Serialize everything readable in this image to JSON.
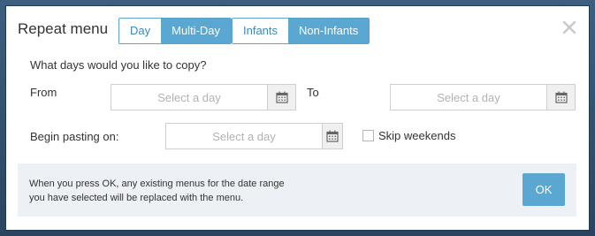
{
  "dialog": {
    "title": "Repeat menu",
    "close_icon": "close-icon"
  },
  "range_toggle": {
    "options": [
      "Day",
      "Multi-Day"
    ],
    "selected": "Multi-Day"
  },
  "group_toggle": {
    "options": [
      "Infants",
      "Non-Infants"
    ],
    "selected": "Non-Infants"
  },
  "form": {
    "question": "What days would you like to copy?",
    "from_label": "From",
    "to_label": "To",
    "begin_label": "Begin pasting on:",
    "from_placeholder": "Select a day",
    "to_placeholder": "Select a day",
    "begin_placeholder": "Select a day",
    "from_value": "",
    "to_value": "",
    "begin_value": "",
    "calendar_icon": "calendar-icon",
    "skip_weekends_label": "Skip weekends",
    "skip_weekends_checked": false
  },
  "footer": {
    "note_line1": "When you press OK, any existing menus for the date range",
    "note_line2": "you have selected will be replaced with the menu.",
    "ok_label": "OK"
  },
  "colors": {
    "accent": "#5aa7d2",
    "accent_text": "#3a89bb",
    "footer_bg": "#edf0f4"
  }
}
